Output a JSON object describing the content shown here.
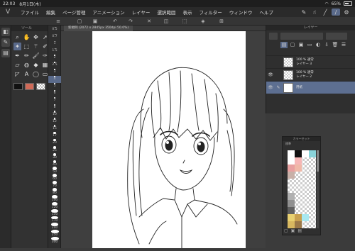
{
  "status": {
    "time": "22:03",
    "date": "8月1日(木)",
    "battery": "65%",
    "battery_level": 0.65
  },
  "menu": [
    "ファイル",
    "編集",
    "ページ管理",
    "アニメーション",
    "レイヤー",
    "選択範囲",
    "表示",
    "フィルター",
    "ウィンドウ",
    "ヘルプ"
  ],
  "document": {
    "title": "新規例 (2072 x 2845px 350dpi 50.0%)"
  },
  "tool_panel": {
    "title": "ツール"
  },
  "brush_sizes": {
    "values": [
      "0.5",
      "0.7",
      "1",
      "1.5",
      "2",
      "2.5",
      "3",
      "4",
      "5",
      "6",
      "7",
      "8",
      "10",
      "12",
      "15",
      "17",
      "20",
      "25",
      "30",
      "40",
      "50",
      "60",
      "70",
      "80",
      "100",
      "120",
      "150",
      "170",
      "200",
      "250",
      "300"
    ],
    "selected": "4"
  },
  "colors": {
    "main": "#111111",
    "sub": "#d06a58"
  },
  "layer_panel": {
    "title": "レイヤー",
    "layers": [
      {
        "mode": "100 % 通常",
        "name": "レイヤー 3",
        "visible": false,
        "selected": false
      },
      {
        "mode": "100 % 通常",
        "name": "レイヤー 2",
        "visible": true,
        "selected": false
      },
      {
        "mode": "",
        "name": "用紙",
        "visible": true,
        "selected": true
      }
    ]
  },
  "colorset": {
    "title": "カラーセット",
    "subtitle": "標準",
    "swatches": [
      "#ffffff",
      "#111111",
      "#ffffff",
      "#8ad4da",
      "#ffffff",
      "#f6b6b6",
      "#ffffff",
      "#ffffff",
      "#e8a0a0",
      "#f0b8a8",
      "#ffffff",
      "#ffffff",
      "#c8b0a8",
      "#ffffff",
      "#ffffff",
      "#ffffff",
      "#ffffff",
      "#ffffff",
      "#ffffff",
      "#ffffff",
      "#ffffff",
      "#ffffff",
      "#ffffff",
      "#ffffff",
      "#b0b0b0",
      "#ffffff",
      "#ffffff",
      "#ffffff",
      "#909090",
      "#ffffff",
      "#ffffff",
      "#ffffff",
      "#606060",
      "#ffffff",
      "#ffffff",
      "#ffffff",
      "#e8d070",
      "#c8a050",
      "#a8e8f0",
      "#ffffff",
      "#d8b860",
      "#9a7848",
      "#ffffff",
      "#ffffff"
    ]
  }
}
